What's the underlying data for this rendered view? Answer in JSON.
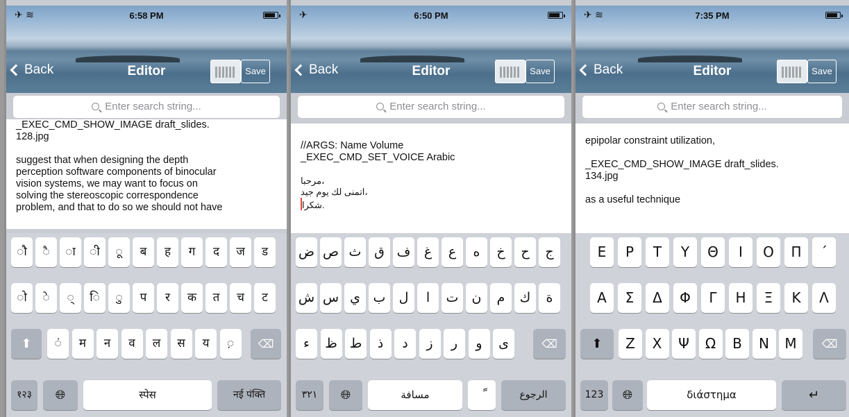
{
  "panels": [
    {
      "time": "6:58 PM",
      "back": "Back",
      "title": "Editor",
      "save": "Save",
      "search_placeholder": "Enter search string...",
      "text_lines": [
        "_EXEC_CMD_SHOW_IMAGE draft_slides.",
        "128.jpg",
        "",
        "suggest that when designing the depth",
        "perception software components of  binocular",
        "vision systems, we may want to focus on",
        "solving the stereoscopic correspondence",
        "problem, and that to do so we should not have"
      ],
      "keyboard": {
        "rows": [
          [
            "ौ",
            "ै",
            "ा",
            "ी",
            "ू",
            "ब",
            "ह",
            "ग",
            "द",
            "ज",
            "ड"
          ],
          [
            "ो",
            "े",
            "्",
            "ि",
            "ु",
            "प",
            "र",
            "क",
            "त",
            "च",
            "ट"
          ],
          [
            "ं",
            "म",
            "न",
            "व",
            "ल",
            "स",
            "य",
            "़"
          ]
        ],
        "numbers": "१२३",
        "space": "स्पेस",
        "return": "नई पंक्ति"
      }
    },
    {
      "time": "6:50 PM",
      "back": "Back",
      "title": "Editor",
      "save": "Save",
      "search_placeholder": "Enter search string...",
      "text_lines": [
        "//ARGS: Name Volume",
        "_EXEC_CMD_SET_VOICE Arabic",
        ""
      ],
      "arabic_lines": [
        "مرحبا،",
        "اتمنى لك يوم جيد،",
        "شكرا."
      ],
      "keyboard": {
        "rows": [
          [
            "ض",
            "ص",
            "ث",
            "ق",
            "ف",
            "غ",
            "ع",
            "ه",
            "خ",
            "ح",
            "ج"
          ],
          [
            "ش",
            "س",
            "ي",
            "ب",
            "ل",
            "ا",
            "ت",
            "ن",
            "م",
            "ك",
            "ة"
          ],
          [
            "ء",
            "ظ",
            "ط",
            "ذ",
            "د",
            "ز",
            "ر",
            "و",
            "ى"
          ]
        ],
        "numbers": "٣٢١",
        "space": "مسافة",
        "accent": "ً",
        "return": "الرجوع"
      }
    },
    {
      "time": "7:35 PM",
      "back": "Back",
      "title": "Editor",
      "save": "Save",
      "search_placeholder": "Enter search string...",
      "text_lines": [
        "epipolar constraint utilization,",
        "",
        "_EXEC_CMD_SHOW_IMAGE draft_slides.",
        "134.jpg",
        "",
        "as a useful technique"
      ],
      "keyboard": {
        "rows": [
          [
            "Ε",
            "Ρ",
            "Τ",
            "Υ",
            "Θ",
            "Ι",
            "Ο",
            "Π",
            "´"
          ],
          [
            "Α",
            "Σ",
            "Δ",
            "Φ",
            "Γ",
            "Η",
            "Ξ",
            "Κ",
            "Λ"
          ],
          [
            "Ζ",
            "Χ",
            "Ψ",
            "Ω",
            "Β",
            "Ν",
            "Μ"
          ]
        ],
        "numbers": "123",
        "space": "διάστημα",
        "return_icon": "return-arrow-icon"
      }
    }
  ]
}
